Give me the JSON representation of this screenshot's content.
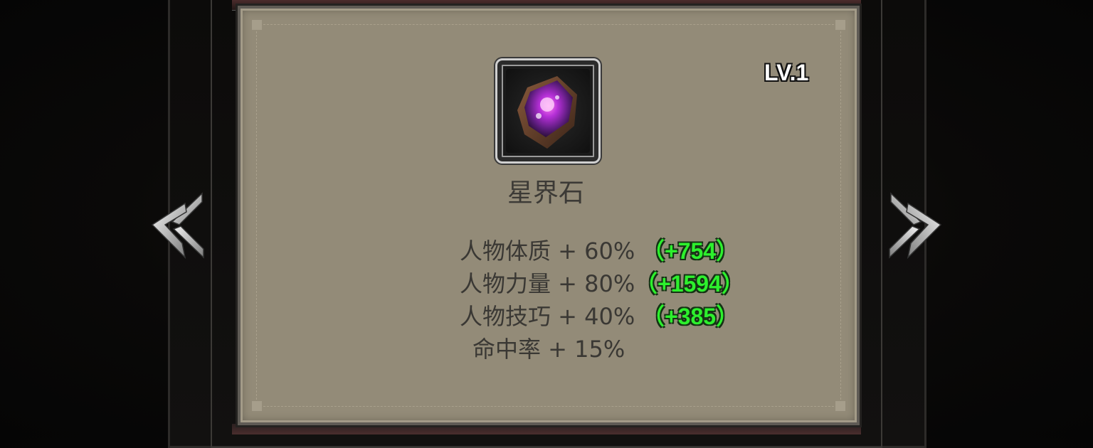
{
  "item": {
    "name": "星界石",
    "level": "LV.1",
    "icon": "astral-stone-gem-icon"
  },
  "stats": [
    {
      "label": "人物体质 + 60%",
      "bonus": "（+754）"
    },
    {
      "label": "人物力量 + 80%",
      "bonus": "（+1594）"
    },
    {
      "label": "人物技巧 + 40%",
      "bonus": "（+385）"
    },
    {
      "label": "命中率 + 15%",
      "bonus": ""
    }
  ],
  "colors": {
    "panel_bg": "#938b78",
    "bonus_green": "#2df02d",
    "stat_text": "#3a3834"
  }
}
